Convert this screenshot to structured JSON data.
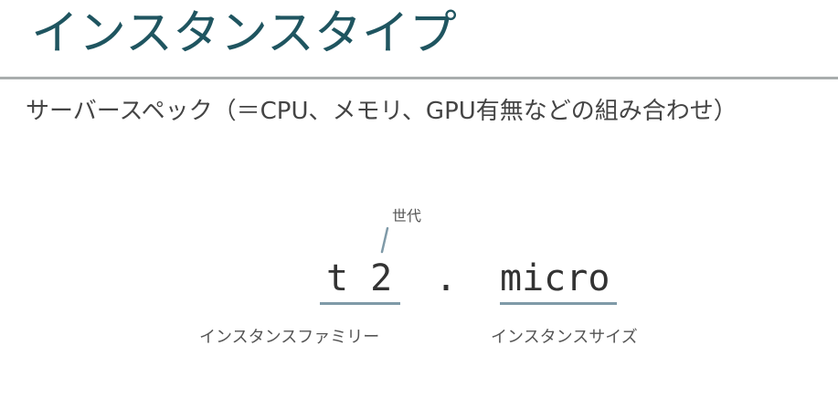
{
  "slide": {
    "title": "インスタンスタイプ",
    "subtitle": "サーバースペック（＝CPU、メモリ、GPU有無などの組み合わせ）"
  },
  "diagram": {
    "generation_label": "世代",
    "family_code": "t 2",
    "separator": ".",
    "size_code": "micro",
    "family_caption": "インスタンスファミリー",
    "size_caption": "インスタンスサイズ"
  },
  "colors": {
    "title": "#1f5560",
    "divider": "#a9adad",
    "underline": "#7f9aa8",
    "text": "#444444"
  }
}
